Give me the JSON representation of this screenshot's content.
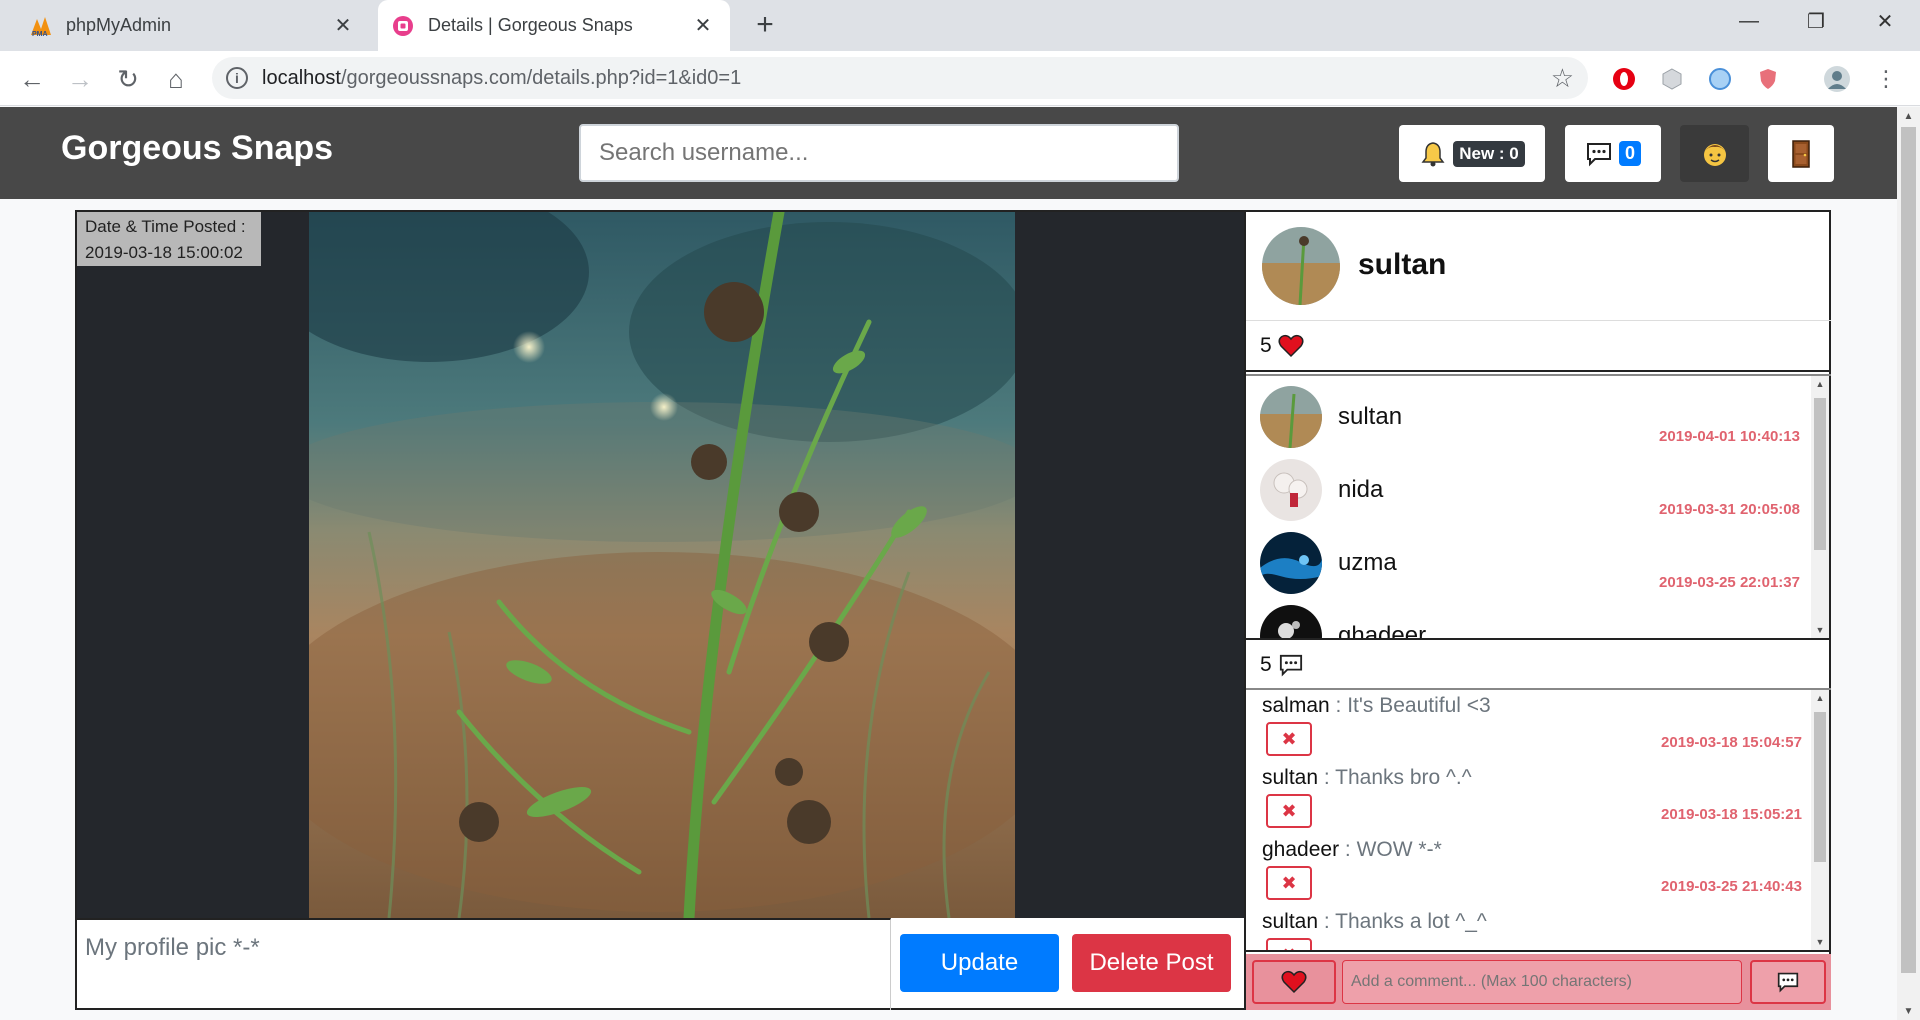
{
  "browser": {
    "tabs": [
      {
        "title": "phpMyAdmin",
        "active": false
      },
      {
        "title": "Details | Gorgeous Snaps",
        "active": true
      }
    ],
    "url_host": "localhost",
    "url_path": "/gorgeoussnaps.com/details.php?id=1&id0=1"
  },
  "navbar": {
    "brand": "Gorgeous Snaps",
    "search_placeholder": "Search username...",
    "notifications_label": "New : 0",
    "messages_count": "0"
  },
  "post": {
    "date_label": "Date & Time Posted :",
    "date_value": "2019-03-18 15:00:02",
    "caption": "My profile pic *-*",
    "update_label": "Update",
    "delete_label": "Delete Post",
    "owner": "sultan",
    "likes_count": "5",
    "comments_count": "5"
  },
  "likers": [
    {
      "name": "sultan",
      "time": "2019-04-01 10:40:13"
    },
    {
      "name": "nida",
      "time": "2019-03-31 20:05:08"
    },
    {
      "name": "uzma",
      "time": "2019-03-25 22:01:37"
    },
    {
      "name": "ghadeer",
      "time": ""
    }
  ],
  "comments": [
    {
      "user": "salman",
      "sep": " : ",
      "text": "It's Beautiful <3",
      "time": "2019-03-18 15:04:57"
    },
    {
      "user": "sultan",
      "sep": " : ",
      "text": "Thanks bro ^.^",
      "time": "2019-03-18 15:05:21"
    },
    {
      "user": "ghadeer",
      "sep": " : ",
      "text": "WOW *-*",
      "time": "2019-03-25 21:40:43"
    },
    {
      "user": "sultan",
      "sep": " : ",
      "text": "Thanks a lot ^_^",
      "time": ""
    }
  ],
  "comment_form": {
    "placeholder": "Add a comment... (Max 100 characters)"
  },
  "colors": {
    "navbar": "#484848",
    "primary": "#007bff",
    "danger": "#dc3545",
    "timestamp": "#e0636f",
    "comment_bar": "#e8919c"
  }
}
